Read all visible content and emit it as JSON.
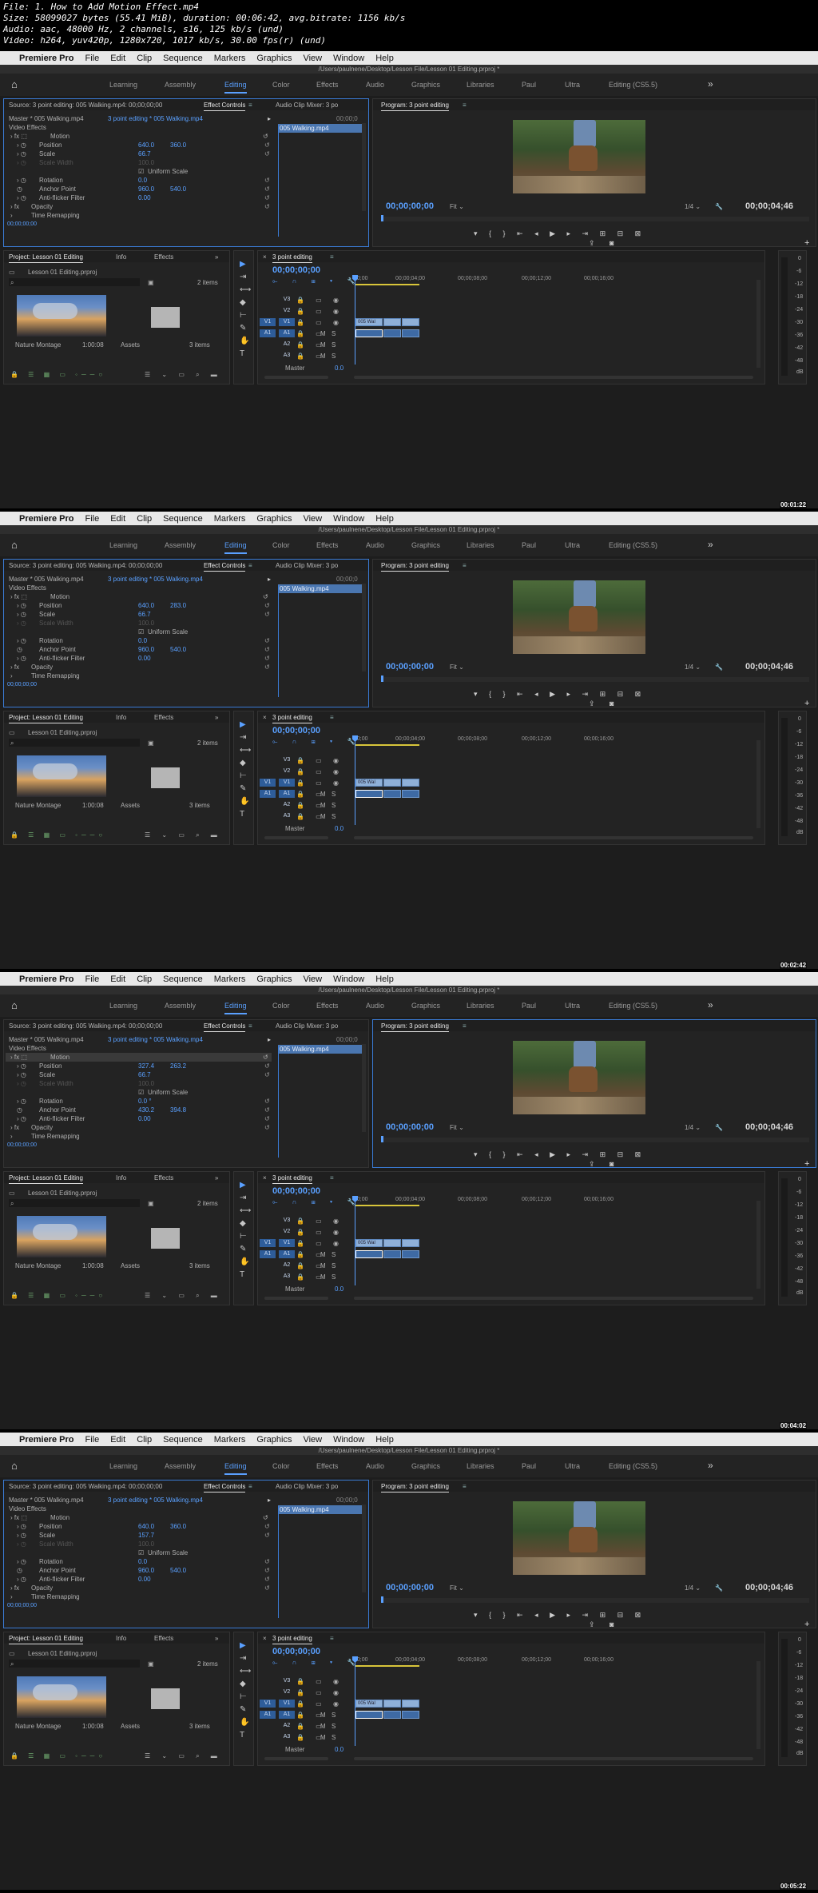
{
  "file_info": [
    "File: 1. How to Add Motion Effect.mp4",
    "Size: 58099027 bytes (55.41 MiB), duration: 00:06:42, avg.bitrate: 1156 kb/s",
    "Audio: aac, 48000 Hz, 2 channels, s16, 125 kb/s (und)",
    "Video: h264, yuv420p, 1280x720, 1017 kb/s, 30.00 fps(r) (und)"
  ],
  "mac_menu": {
    "app": "Premiere Pro",
    "items": [
      "File",
      "Edit",
      "Clip",
      "Sequence",
      "Markers",
      "Graphics",
      "View",
      "Window",
      "Help"
    ]
  },
  "path": "/Users/paulnene/Desktop/Lesson File/Lesson 01 Editing.prproj *",
  "workspaces": [
    "Learning",
    "Assembly",
    "Editing",
    "Color",
    "Effects",
    "Audio",
    "Graphics",
    "Libraries",
    "Paul",
    "Ultra",
    "Editing (CS5.5)"
  ],
  "workspace_active": "Editing",
  "source_panel": {
    "tab_source": "Source: 3 point editing: 005 Walking.mp4: 00;00;00;00",
    "tab_effect_controls": "Effect Controls",
    "tab_audio_mixer": "Audio Clip Mixer: 3 po",
    "master_label": "Master * 005 Walking.mp4",
    "sequence_label": "3 point editing * 005 Walking.mp4",
    "clip_name": "005 Walking.mp4",
    "mini_tc": "00;00;0",
    "video_effects": "Video Effects",
    "motion": "Motion",
    "position": "Position",
    "scale": "Scale",
    "scale_width": "Scale Width",
    "scale_width_value": "100.0",
    "uniform_scale": "Uniform Scale",
    "rotation": "Rotation",
    "anchor_point": "Anchor Point",
    "anti_flicker": "Anti-flicker Filter",
    "opacity": "Opacity",
    "time_remapping": "Time Remapping",
    "footer_tc": "00;00;00;00"
  },
  "program_panel": {
    "tab": "Program: 3 point editing",
    "timecode": "00;00;00;00",
    "fit": "Fit",
    "quality": "1/4",
    "duration": "00;00;04;46"
  },
  "project_panel": {
    "tab_project": "Project: Lesson 01 Editing",
    "tab_info": "Info",
    "tab_effects": "Effects",
    "file": "Lesson 01 Editing.prproj",
    "items_count": "2 items",
    "item1_name": "Nature Montage",
    "item1_dur": "1:00:08",
    "item2_name": "Assets",
    "item2_count": "3 items"
  },
  "timeline_panel": {
    "tab": "3 point editing",
    "timecode": "00;00;00;00",
    "ruler": [
      "00;00",
      "00;00;04;00",
      "00;00;08;00",
      "00;00;12;00",
      "00;00;16;00"
    ],
    "video_tracks": [
      "V3",
      "V2",
      "V1"
    ],
    "audio_tracks": [
      "A1",
      "A2",
      "A3"
    ],
    "target_v": "V1",
    "target_a": "A1",
    "master": "Master",
    "master_value": "0.0",
    "clip_label": "005 Wal",
    "m": "M",
    "s": "S"
  },
  "vu_scale": [
    "0",
    "-6",
    "-12",
    "-18",
    "-24",
    "-30",
    "-36",
    "-42",
    "-48",
    "dB"
  ],
  "frames": [
    {
      "position_x": "640.0",
      "position_y": "360.0",
      "scale": "66.7",
      "rotation": "0.0",
      "anchor_x": "960.0",
      "anchor_y": "540.0",
      "anti_flicker": "0.00",
      "timestamp": "00:01:22",
      "motion_selected": false
    },
    {
      "position_x": "640.0",
      "position_y": "283.0",
      "scale": "66.7",
      "rotation": "0.0",
      "anchor_x": "960.0",
      "anchor_y": "540.0",
      "anti_flicker": "0.00",
      "timestamp": "00:02:42",
      "motion_selected": false
    },
    {
      "position_x": "327.4",
      "position_y": "263.2",
      "scale": "66.7",
      "rotation": "0.0 °",
      "anchor_x": "430.2",
      "anchor_y": "394.8",
      "anti_flicker": "0.00",
      "timestamp": "00:04:02",
      "motion_selected": true
    },
    {
      "position_x": "640.0",
      "position_y": "360.0",
      "scale": "157.7",
      "rotation": "0.0",
      "anchor_x": "960.0",
      "anchor_y": "540.0",
      "anti_flicker": "0.00",
      "timestamp": "00:05:22",
      "motion_selected": false
    }
  ],
  "colors": {
    "accent": "#5aa0ff",
    "panel_bg": "#232323",
    "app_bg": "#1d1d1d",
    "clip_video": "#8fb0d8",
    "clip_audio": "#3e6aa4",
    "in_out": "#d8c53a"
  }
}
